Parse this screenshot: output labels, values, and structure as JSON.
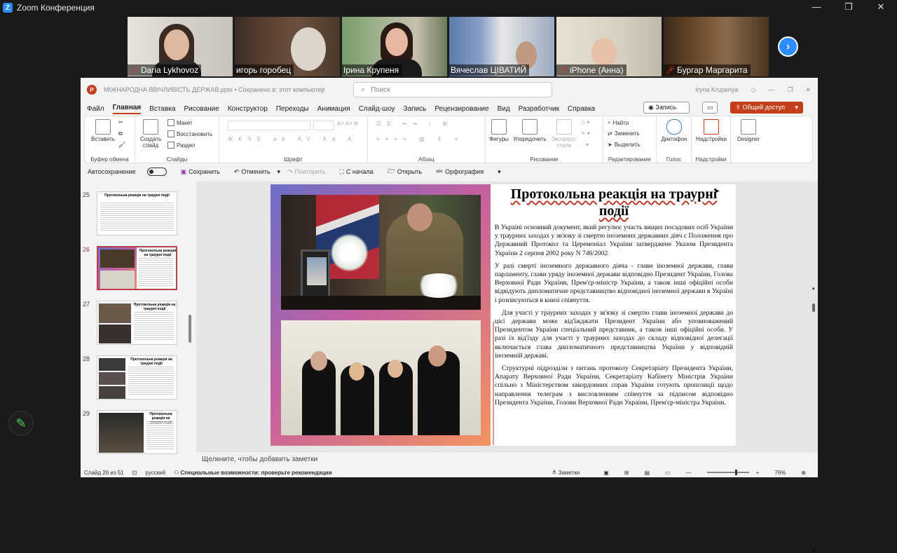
{
  "zoom": {
    "title": "Zoom Конференция",
    "window_controls": [
      "—",
      "❐",
      "✕"
    ],
    "participants": [
      {
        "name": "Daria Lykhovoz",
        "muted": true
      },
      {
        "name": "игорь горобец",
        "muted": false
      },
      {
        "name": "Ірина Крупеня",
        "muted": false
      },
      {
        "name": "Вячеслав ЦІВАТИЙ",
        "muted": false
      },
      {
        "name": "iPhone (Анна)",
        "muted": true
      },
      {
        "name": "Бургар Маргарита",
        "muted": true
      }
    ],
    "next_icon": "›"
  },
  "ppt": {
    "file_title": "МІЖНАРОДНА ВВІЧЛИВІСТЬ ДЕРЖАВ.pptx • Сохранено в: этот компьютер",
    "search_placeholder": "Поиск",
    "user": "Iryna Krupenya",
    "menu": [
      "Файл",
      "Главная",
      "Вставка",
      "Рисование",
      "Конструктор",
      "Переходы",
      "Анимация",
      "Слайд-шоу",
      "Запись",
      "Рецензирование",
      "Вид",
      "Разработчик",
      "Справка"
    ],
    "record_label": "Запись",
    "share_label": "Общий доступ",
    "ribbon": {
      "paste": "Вставить",
      "clipboard": "Буфер обмена",
      "new_slide": "Создать слайд",
      "layout": "Макет",
      "reset": "Восстановить",
      "section": "Раздел",
      "slides": "Слайды",
      "font": "Шрифт",
      "paragraph": "Абзац",
      "shapes": "Фигуры",
      "arrange": "Упорядочить",
      "quick_styles": "Экспресс-стили",
      "drawing": "Рисование",
      "find": "Найти",
      "replace": "Заменить",
      "select": "Выделить",
      "editing": "Редактирование",
      "dictate": "Диктофон",
      "voice": "Голос",
      "addins": "Надстройки",
      "addins_group": "Надстройки",
      "designer": "Designer"
    },
    "qat": {
      "autosave": "Автосохранение",
      "save": "Сохранить",
      "undo": "Отменить",
      "redo": "Повторить",
      "from_start": "С начала",
      "open": "Открыть",
      "spelling": "Орфография"
    },
    "thumbs": [
      {
        "num": "25",
        "title": "Протокольна реакція на траурні події"
      },
      {
        "num": "26",
        "title": "Протокольна реакція на траурні події"
      },
      {
        "num": "27",
        "title": "Протокольна реакція на траурні події"
      },
      {
        "num": "28",
        "title": "Протокольна реакція на траурні події"
      },
      {
        "num": "29",
        "title": "Протокольна реакція на траурні події"
      }
    ],
    "slide": {
      "title": "Протокольна реакція на траурні події",
      "p1": "В Україні основний документ, який регулює участь вищих посадових осіб України у траурних заходах у зв'язку зі смертю іноземних державних діяч є Положення про Державний Протокол та Церемоніал України затверджене Указом Президента України 2 серпня 2002 року N 746/2002",
      "p2": "У разі смерті іноземного державного діяча - глави іноземної держави, глави парламенту, глави уряду іноземної держави відповідно Президент України, Голова Верховної Ради України, Прем'єр-міністр України, а також інші офіційні особи відвідують дипломатичне представництво відповідної іноземної держави в Україні і розписуються в книзі співчуття.",
      "p3": "Для участі у траурних заходах у зв'язку зі смертю глави іноземної держави до цієї держави може від'їжджати Президент України або уповноважений Президентом України спеціальний представник, а також інші офіційні особи. У разі їх від'їзду для участі у траурних заходах до складу відповідної делегації включається глава дипломатичного представництва України у відповідній іноземній державі.",
      "p4": "Структурні підрозділи з питань протоколу Секретаріату Президента України, Апарату Верховної Ради України, Секретаріату Кабінету Міністрів України спільно з Міністерством закордонних справ України готують пропозиції щодо направлення телеграм з висловленням співчуття за підписом відповідно Президента України, Голови Верховної Ради України, Прем'єр-міністра України."
    },
    "notes_placeholder": "Щелкните, чтобы добавить заметки",
    "status": {
      "slide": "Слайд 26 из 51",
      "lang": "русский",
      "accessibility": "Специальные возможности: проверьте рекомендации",
      "notes": "Заметки",
      "zoom": "76%"
    }
  }
}
